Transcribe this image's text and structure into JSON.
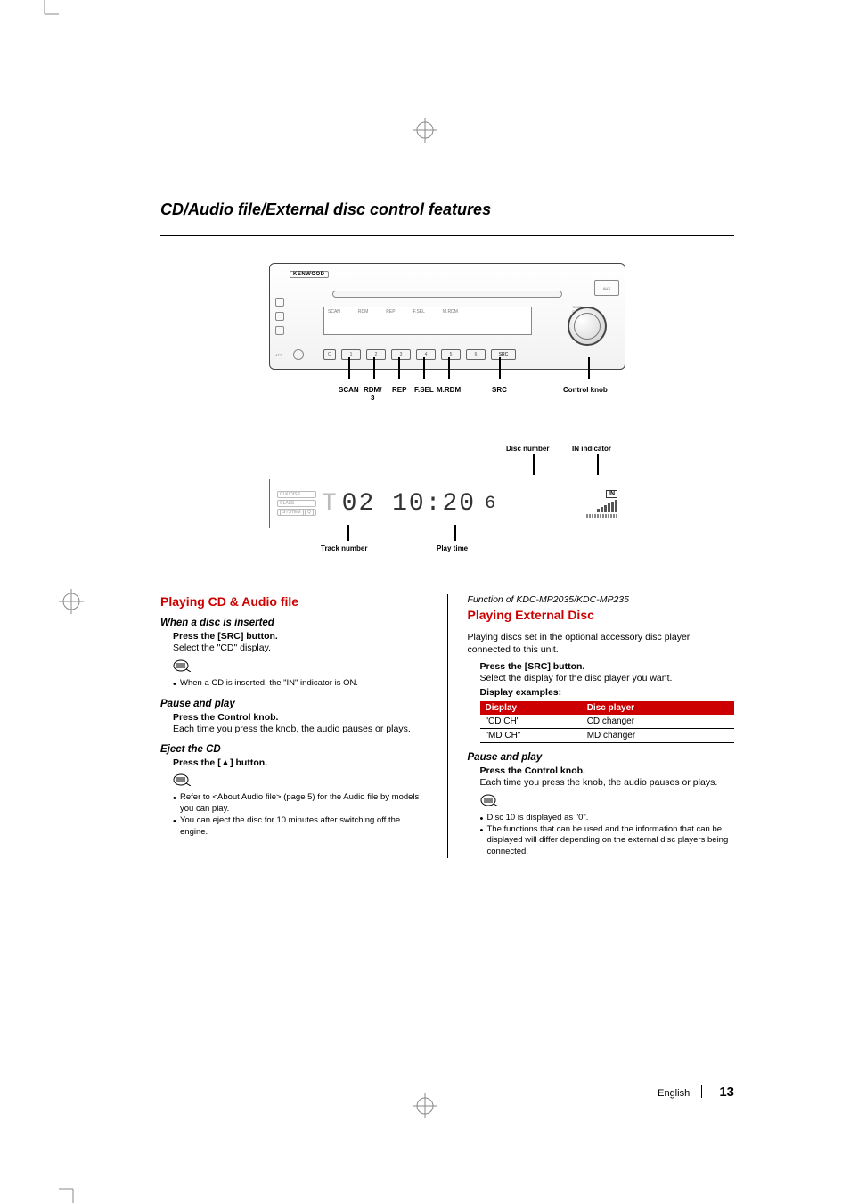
{
  "section_title": "CD/Audio file/External disc control features",
  "device": {
    "brand": "KENWOOD",
    "buttons": [
      "1",
      "2",
      "3",
      "4",
      "5",
      "6"
    ],
    "src_label": "SRC",
    "att_label": "ATT",
    "aux_label": "AUX",
    "screen_labels_top": [
      "SCAN",
      "RDM",
      "REP",
      "F.SEL",
      "M.RDM"
    ],
    "eject_glyph": "▲"
  },
  "callouts_bottom": {
    "scan": "SCAN",
    "rdm": "RDM/\n3",
    "rep": "REP",
    "fsel": "F.SEL",
    "mrdm": "M.RDM",
    "src": "SRC",
    "knob": "Control knob"
  },
  "lcd": {
    "left_badges": [
      "CLK/DISP",
      "CLASS",
      "SYSTEM"
    ],
    "left_badges_suffix": [
      "",
      "",
      "Q"
    ],
    "track_prefix": "T",
    "digits": "02 10:20",
    "disc_digit": "6",
    "in_label": "IN"
  },
  "lcd_callouts_top": {
    "disc_number": "Disc number",
    "in_indicator": "IN indicator"
  },
  "lcd_callouts_bottom": {
    "track_number": "Track number",
    "play_time": "Play time"
  },
  "left_col": {
    "h_red": "Playing CD & Audio file",
    "sec1_h": "When a disc is inserted",
    "sec1_step": "Press the [SRC] button.",
    "sec1_body": "Select the \"CD\" display.",
    "sec1_note1": "When a CD is inserted, the \"IN\" indicator is ON.",
    "sec2_h": "Pause and play",
    "sec2_step": "Press the Control knob.",
    "sec2_body": "Each time you press the knob, the audio pauses or plays.",
    "sec3_h": "Eject the CD",
    "sec3_step_prefix": "Press the [",
    "sec3_step_glyph": "▲",
    "sec3_step_suffix": "] button.",
    "sec3_note1": "Refer to <About Audio file> (page 5) for the Audio file by models you can play.",
    "sec3_note2": "You can eject the disc for 10 minutes after switching off the engine."
  },
  "right_col": {
    "func_line": "Function of KDC-MP2035/KDC-MP235",
    "h_red": "Playing External Disc",
    "intro": "Playing discs set in the optional accessory disc player connected to this unit.",
    "step1": "Press the [SRC] button.",
    "step1_body": "Select the display for the disc player you want.",
    "examples_h": "Display examples:",
    "table": {
      "headers": [
        "Display",
        "Disc player"
      ],
      "rows": [
        [
          "\"CD CH\"",
          "CD changer"
        ],
        [
          "\"MD CH\"",
          "MD changer"
        ]
      ]
    },
    "sec2_h": "Pause and play",
    "sec2_step": "Press the Control knob.",
    "sec2_body": "Each time you press the knob, the audio pauses or plays.",
    "note1": "Disc 10 is displayed as \"0\".",
    "note2": "The functions that can be used and the information that can be displayed will differ depending on the external disc players being connected."
  },
  "footer": {
    "lang": "English",
    "page": "13"
  }
}
